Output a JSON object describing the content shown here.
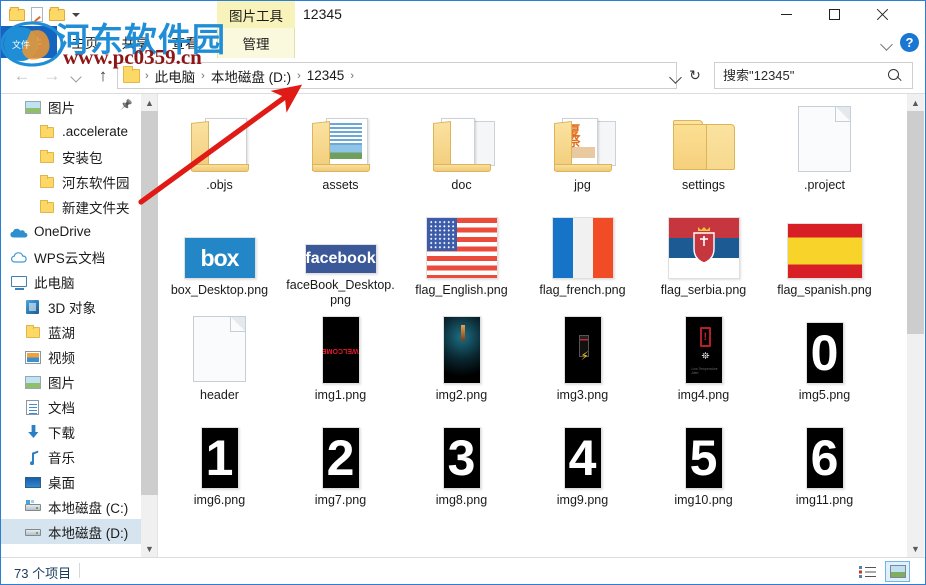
{
  "window": {
    "title": "12345",
    "controls": {
      "minimize": "—",
      "maximize": "□",
      "close": "✕",
      "help": "?"
    }
  },
  "ribbon": {
    "file_tab": "文件",
    "tabs": [
      {
        "label": "主页"
      },
      {
        "label": "共享"
      },
      {
        "label": "查看"
      }
    ],
    "contextual": {
      "group_title": "图片工具",
      "tab_label": "管理"
    }
  },
  "addressbar": {
    "back": "←",
    "forward": "→",
    "up": "↑",
    "refresh": "↻",
    "breadcrumbs": [
      {
        "label": "此电脑"
      },
      {
        "label": "本地磁盘 (D:)"
      },
      {
        "label": "12345"
      }
    ],
    "separator": "›"
  },
  "search": {
    "placeholder": "搜索\"12345\"",
    "value": ""
  },
  "sidebar": {
    "items": [
      {
        "label": "图片",
        "icon": "picture-icon",
        "indent": 1,
        "pinned": true,
        "selected": false
      },
      {
        "label": ".accelerate",
        "icon": "folder-icon",
        "indent": 2,
        "pinned": false,
        "selected": false
      },
      {
        "label": "安装包",
        "icon": "folder-icon",
        "indent": 2,
        "pinned": false,
        "selected": false
      },
      {
        "label": "河东软件园",
        "icon": "folder-icon",
        "indent": 2,
        "pinned": false,
        "selected": false
      },
      {
        "label": "新建文件夹",
        "icon": "folder-icon",
        "indent": 2,
        "pinned": false,
        "selected": false
      },
      {
        "label": "OneDrive",
        "icon": "onedrive-icon",
        "indent": 0,
        "pinned": false,
        "selected": false
      },
      {
        "label": "WPS云文档",
        "icon": "wps-cloud-icon",
        "indent": 0,
        "pinned": false,
        "selected": false
      },
      {
        "label": "此电脑",
        "icon": "this-pc-icon",
        "indent": 0,
        "pinned": false,
        "selected": false
      },
      {
        "label": "3D 对象",
        "icon": "3d-objects-icon",
        "indent": 1,
        "pinned": false,
        "selected": false
      },
      {
        "label": "蓝湖",
        "icon": "folder-icon",
        "indent": 1,
        "pinned": false,
        "selected": false
      },
      {
        "label": "视频",
        "icon": "video-icon",
        "indent": 1,
        "pinned": false,
        "selected": false
      },
      {
        "label": "图片",
        "icon": "picture-icon",
        "indent": 1,
        "pinned": false,
        "selected": false
      },
      {
        "label": "文档",
        "icon": "document-icon",
        "indent": 1,
        "pinned": false,
        "selected": false
      },
      {
        "label": "下载",
        "icon": "download-icon",
        "indent": 1,
        "pinned": false,
        "selected": false
      },
      {
        "label": "音乐",
        "icon": "music-icon",
        "indent": 1,
        "pinned": false,
        "selected": false
      },
      {
        "label": "桌面",
        "icon": "desktop-icon",
        "indent": 1,
        "pinned": false,
        "selected": false
      },
      {
        "label": "本地磁盘 (C:)",
        "icon": "drive-c-icon",
        "indent": 1,
        "pinned": false,
        "selected": false
      },
      {
        "label": "本地磁盘 (D:)",
        "icon": "drive-icon",
        "indent": 1,
        "pinned": false,
        "selected": true
      }
    ]
  },
  "files": [
    {
      "name": ".objs",
      "kind": "folder-open-doc"
    },
    {
      "name": "assets",
      "kind": "folder-open-lines"
    },
    {
      "name": "doc",
      "kind": "folder-open-doc2"
    },
    {
      "name": "jpg",
      "kind": "folder-open-photo"
    },
    {
      "name": "settings",
      "kind": "folder-closed"
    },
    {
      "name": ".project",
      "kind": "file-blank"
    },
    {
      "name": "box_Desktop.png",
      "kind": "thumb-box"
    },
    {
      "name": "faceBook_Desktop.png",
      "kind": "thumb-facebook"
    },
    {
      "name": "flag_English.png",
      "kind": "thumb-flag-us"
    },
    {
      "name": "flag_french.png",
      "kind": "thumb-flag-fr"
    },
    {
      "name": "flag_serbia.png",
      "kind": "thumb-flag-rs"
    },
    {
      "name": "flag_spanish.png",
      "kind": "thumb-flag-es"
    },
    {
      "name": "header",
      "kind": "file-blank"
    },
    {
      "name": "img1.png",
      "kind": "thumb-dark-welcome"
    },
    {
      "name": "img2.png",
      "kind": "thumb-dark-glow"
    },
    {
      "name": "img3.png",
      "kind": "thumb-dark-battery"
    },
    {
      "name": "img4.png",
      "kind": "thumb-dark-batt-alert"
    },
    {
      "name": "img5.png",
      "kind": "thumb-num",
      "digit": "0"
    },
    {
      "name": "img6.png",
      "kind": "thumb-num",
      "digit": "1"
    },
    {
      "name": "img7.png",
      "kind": "thumb-num",
      "digit": "2"
    },
    {
      "name": "img8.png",
      "kind": "thumb-num",
      "digit": "3"
    },
    {
      "name": "img9.png",
      "kind": "thumb-num",
      "digit": "4"
    },
    {
      "name": "img10.png",
      "kind": "thumb-num",
      "digit": "5"
    },
    {
      "name": "img11.png",
      "kind": "thumb-num",
      "digit": "6"
    }
  ],
  "statusbar": {
    "item_count": "73 个项目"
  },
  "watermark": {
    "line1": "河东软件园",
    "line2": "www.pc0359.cn",
    "color1": "#1f8ed6",
    "color2": "#8d1515"
  },
  "annotation": {
    "arrow_color": "#e01b15"
  }
}
